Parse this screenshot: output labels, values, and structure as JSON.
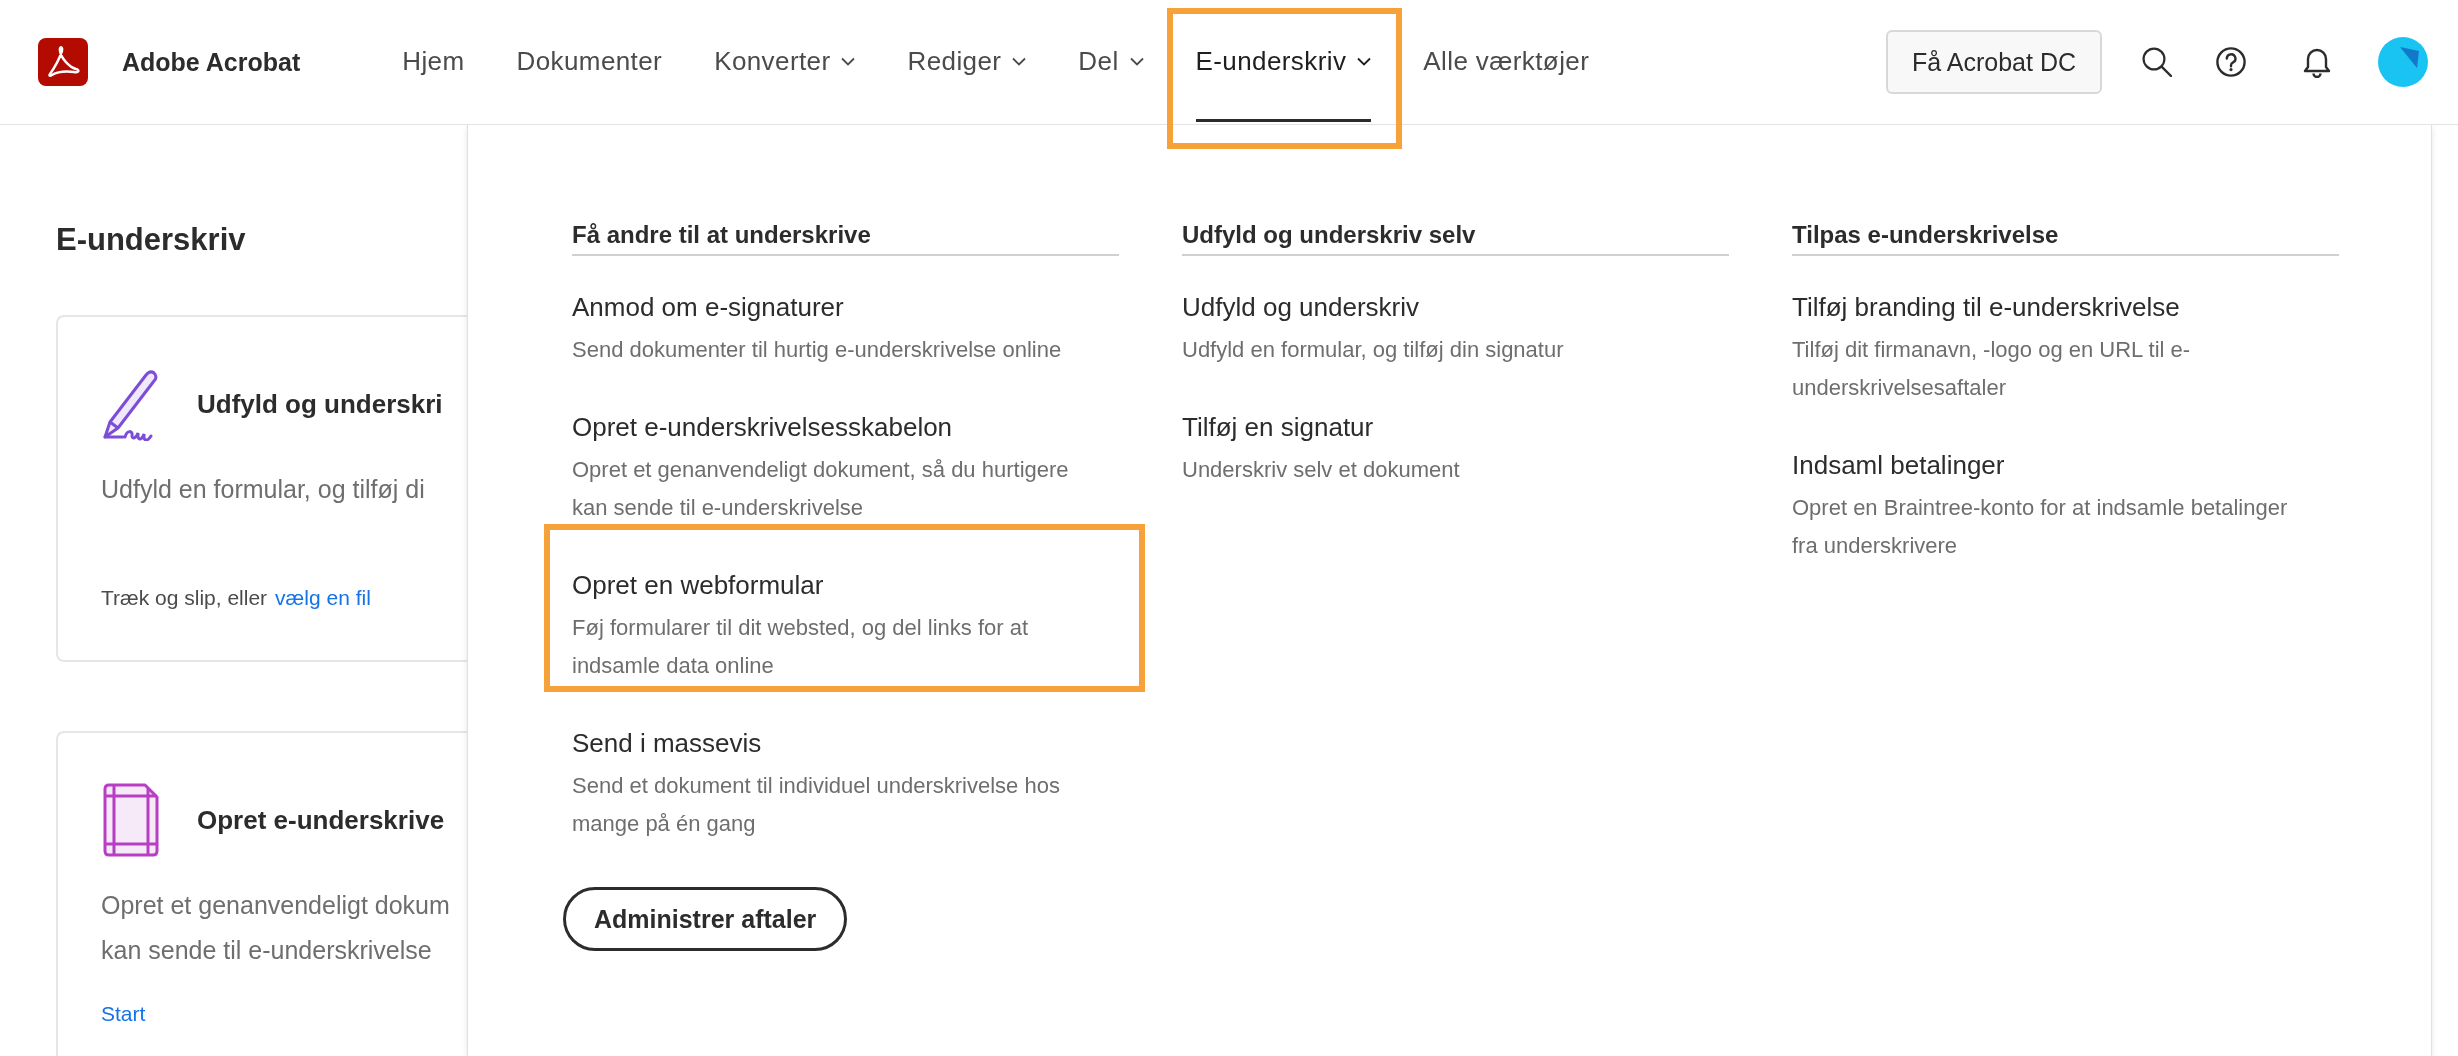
{
  "app": {
    "name": "Adobe Acrobat"
  },
  "nav": [
    {
      "label": "Hjem",
      "has_menu": false,
      "selected": false,
      "highlighted": false
    },
    {
      "label": "Dokumenter",
      "has_menu": false,
      "selected": false,
      "highlighted": false
    },
    {
      "label": "Konverter",
      "has_menu": true,
      "selected": false,
      "highlighted": false
    },
    {
      "label": "Rediger",
      "has_menu": true,
      "selected": false,
      "highlighted": false
    },
    {
      "label": "Del",
      "has_menu": true,
      "selected": false,
      "highlighted": false
    },
    {
      "label": "E-underskriv",
      "has_menu": true,
      "selected": true,
      "highlighted": true
    },
    {
      "label": "Alle værktøjer",
      "has_menu": false,
      "selected": false,
      "highlighted": false
    }
  ],
  "header_actions": {
    "cta": "Få Acrobat DC"
  },
  "page": {
    "title": "E-underskriv",
    "cards": [
      {
        "kind": "pen",
        "title": "Udfyld og underskri",
        "description": [
          "Udfyld en formular, og tilføj di"
        ],
        "footer_text": "Træk og slip, eller",
        "footer_link": "vælg en fil"
      },
      {
        "kind": "template",
        "title": "Opret e-underskrive",
        "description": [
          "Opret et genanvendeligt dokum",
          "kan sende til e-underskrivelse"
        ],
        "footer_link": "Start"
      }
    ]
  },
  "menu": {
    "columns": [
      {
        "heading": "Få andre til at underskrive",
        "items": [
          {
            "title": "Anmod om e-signaturer",
            "description": [
              "Send dokumenter til hurtig e-underskrivelse online"
            ],
            "highlighted": false
          },
          {
            "title": "Opret e-underskrivelsesskabelon",
            "description": [
              "Opret et genanvendeligt dokument, så du hurtigere",
              "kan sende til e-underskrivelse"
            ],
            "highlighted": false
          },
          {
            "title": "Opret en webformular",
            "description": [
              "Føj formularer til dit websted, og del links for at",
              "indsamle data online"
            ],
            "highlighted": true
          },
          {
            "title": "Send i massevis",
            "description": [
              "Send et dokument til individuel underskrivelse hos",
              "mange på én gang"
            ],
            "highlighted": false
          }
        ],
        "button": "Administrer aftaler"
      },
      {
        "heading": "Udfyld og underskriv selv",
        "items": [
          {
            "title": "Udfyld og underskriv",
            "description": [
              "Udfyld en formular, og tilføj din signatur"
            ],
            "highlighted": false
          },
          {
            "title": "Tilføj en signatur",
            "description": [
              "Underskriv selv et dokument"
            ],
            "highlighted": false
          }
        ]
      },
      {
        "heading": "Tilpas e-underskrivelse",
        "items": [
          {
            "title": "Tilføj branding til e-underskrivelse",
            "description": [
              "Tilføj dit firmanavn, -logo og en URL til e-",
              "underskrivelsesaftaler"
            ],
            "highlighted": false
          },
          {
            "title": "Indsaml betalinger",
            "description": [
              "Opret en Braintree-konto for at indsamle betalinger",
              "fra underskrivere"
            ],
            "highlighted": false
          }
        ]
      }
    ]
  }
}
